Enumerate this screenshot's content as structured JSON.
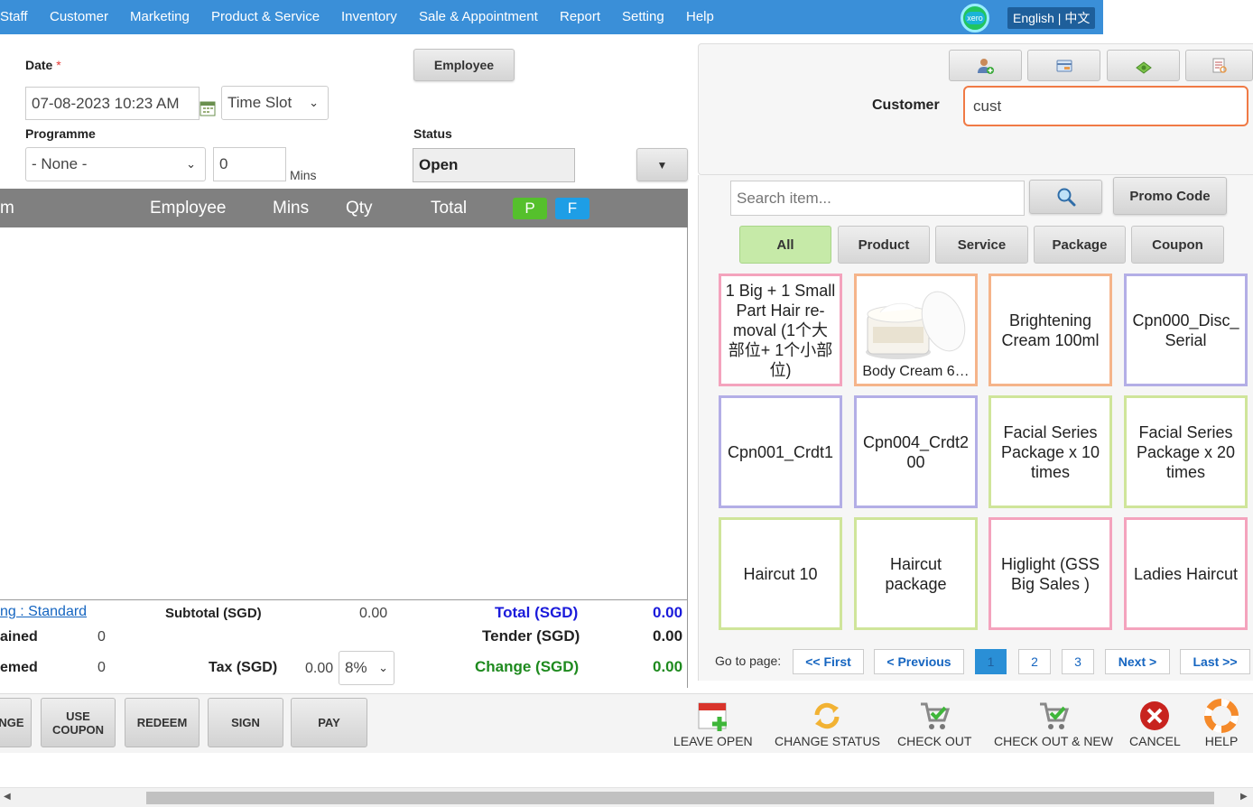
{
  "nav": {
    "items": [
      "Staff",
      "Customer",
      "Marketing",
      "Product & Service",
      "Inventory",
      "Sale & Appointment",
      "Report",
      "Setting",
      "Help"
    ],
    "xero": "xero",
    "language": "English | 中文"
  },
  "form": {
    "date_label": "Date",
    "required_mark": "*",
    "date_value": "07-08-2023 10:23 AM",
    "timeslot": "Time Slot",
    "employee_button": "Employee",
    "programme_label": "Programme",
    "programme_value": "- None -",
    "mins_value": "0",
    "mins_label": "Mins",
    "status_label": "Status",
    "status_value": "Open"
  },
  "table": {
    "headers": {
      "item": "m",
      "employee": "Employee",
      "mins": "Mins",
      "qty": "Qty",
      "total": "Total",
      "p": "P",
      "f": "F"
    }
  },
  "totals": {
    "pricing_link": "ng : Standard",
    "subtotal_label": "Subtotal (SGD)",
    "subtotal_value": "0.00",
    "total_label": "Total (SGD)",
    "total_value": "0.00",
    "gained_label": "ained",
    "gained_value": "0",
    "tender_label": "Tender (SGD)",
    "tender_value": "0.00",
    "redeemed_label": "emed",
    "redeemed_value": "0",
    "tax_label": "Tax (SGD)",
    "tax_value": "0.00",
    "tax_rate": "8%",
    "change_label": "Change (SGD)",
    "change_value": "0.00"
  },
  "customer": {
    "label": "Customer",
    "input_value": "cust"
  },
  "items": {
    "search_placeholder": "Search item...",
    "promo_button": "Promo Code",
    "categories": [
      "All",
      "Product",
      "Service",
      "Package",
      "Coupon"
    ],
    "tiles": [
      "1 Big + 1 Small Part Hair re-moval (1个大部位+ 1个小部位)",
      "Body Cream 6…",
      "Brightening Cream 100ml",
      "Cpn000_Disc_Serial",
      "Cpn001_Crdt1",
      "Cpn004_Crdt200",
      "Facial Series Package x 10 times",
      "Facial Series Package x 20 times",
      "Haircut 10",
      "Haircut package",
      "Higlight (GSS Big Sales )",
      "Ladies Haircut"
    ],
    "colors": {
      "pink": "#f4a3bd",
      "orange": "#f5b48a",
      "purple": "#b3aee6",
      "green": "#cfe59a",
      "all_active": "#c6eaa8",
      "p_pill": "#55c02c",
      "f_pill": "#1e9ee6"
    }
  },
  "pagination": {
    "label": "Go to page:",
    "first": "<< First",
    "previous": "< Previous",
    "pages": [
      "1",
      "2",
      "3"
    ],
    "current": "1",
    "next": "Next >",
    "last": "Last >>"
  },
  "bottom": {
    "buttons": [
      "NGE",
      "USE COUPON",
      "REDEEM",
      "SIGN",
      "PAY"
    ],
    "actions": [
      "LEAVE OPEN",
      "CHANGE STATUS",
      "CHECK OUT",
      "CHECK OUT & NEW",
      "CANCEL",
      "HELP"
    ]
  }
}
